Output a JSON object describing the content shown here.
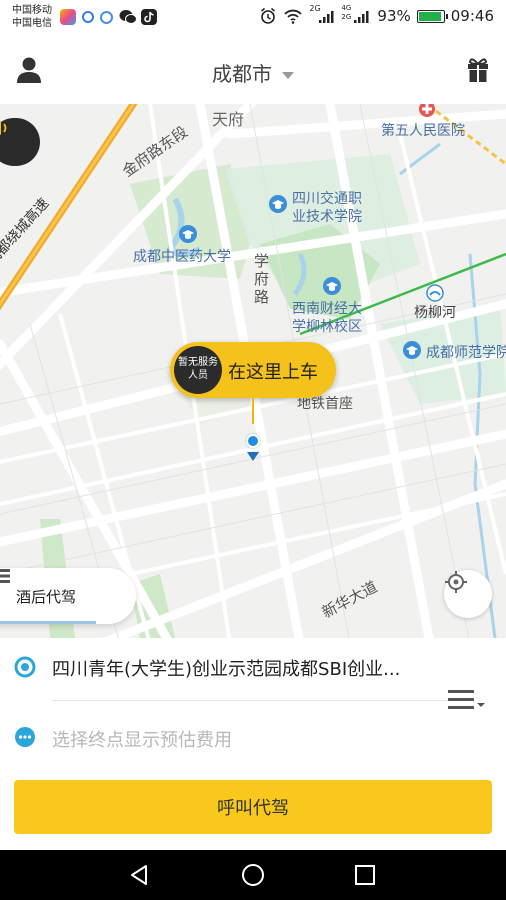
{
  "status_bar": {
    "carrier1": "中国移动",
    "carrier2": "中国电信",
    "net1": "2G",
    "net2": "4G 2G",
    "battery_percent": "93%",
    "battery_level": 0.93,
    "time": "09:46"
  },
  "header": {
    "city": "成都市"
  },
  "map": {
    "labels": {
      "tianfu": "天府",
      "hospital": "第五人民医院",
      "jinfu_road": "金府路东段",
      "highway": "成都绕城高速",
      "sichuan_college_1": "四川交通职",
      "sichuan_college_2": "业技术学院",
      "tcm_university": "成都中医药大学",
      "xuefu_road": "学府路",
      "swufe_1": "西南财经大",
      "swufe_2": "学柳林校区",
      "yangliuhe": "杨柳河",
      "normal_university": "成都师范学院",
      "metro": "地铁首座",
      "xinhua_avenue": "新华大道"
    },
    "pickup": {
      "driver_status": "暂无服务人员",
      "text": "在这里上车"
    },
    "service_tab": {
      "label": "酒后代驾"
    }
  },
  "trip": {
    "start_address": "四川青年(大学生)创业示范园成都SBI创业...",
    "end_placeholder": "选择终点显示预估费用",
    "call_button": "呼叫代驾"
  },
  "colors": {
    "accent_yellow": "#f8c81d",
    "pin_blue": "#1f8ee6",
    "map_bg": "#f1f1ef",
    "park_green": "#cfe8c8"
  }
}
